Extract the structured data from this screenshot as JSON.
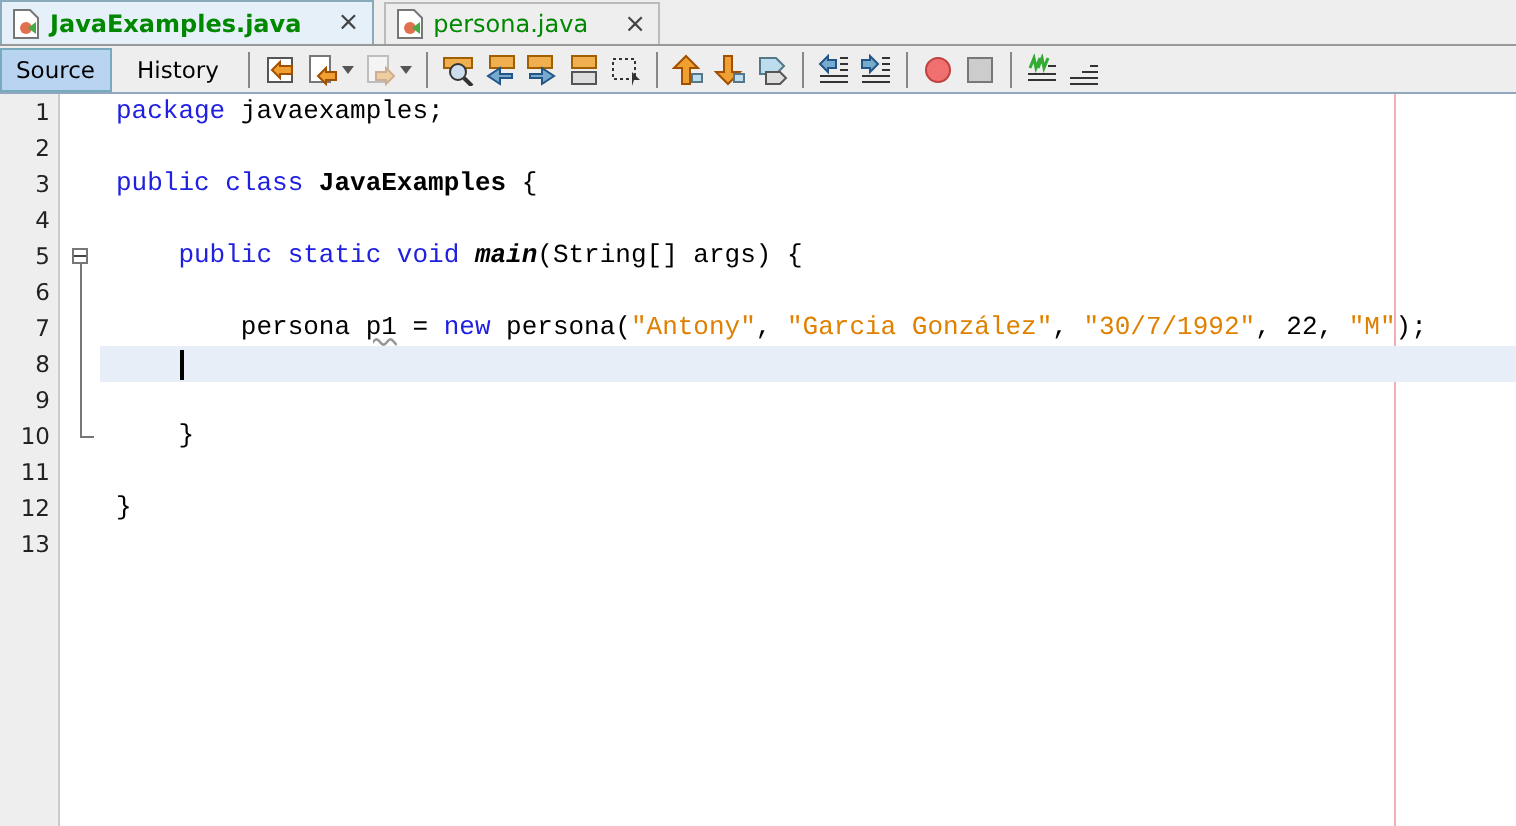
{
  "tabs": [
    {
      "label": "JavaExamples.java",
      "selected": true,
      "close": "×"
    },
    {
      "label": "persona.java",
      "selected": false,
      "close": "×"
    }
  ],
  "view_buttons": [
    {
      "label": "Source",
      "selected": true
    },
    {
      "label": "History",
      "selected": false
    }
  ],
  "toolbar": [
    {
      "kind": "last-edit",
      "disabled": false
    },
    {
      "kind": "back",
      "disabled": false
    },
    {
      "kind": "forward",
      "disabled": true
    },
    {
      "kind": "sep"
    },
    {
      "kind": "find",
      "disabled": false
    },
    {
      "kind": "find-prev",
      "disabled": false
    },
    {
      "kind": "find-next",
      "disabled": false
    },
    {
      "kind": "highlight",
      "disabled": false
    },
    {
      "kind": "rect-select",
      "disabled": false
    },
    {
      "kind": "sep"
    },
    {
      "kind": "up",
      "disabled": false
    },
    {
      "kind": "down",
      "disabled": false
    },
    {
      "kind": "bookmark",
      "disabled": false
    },
    {
      "kind": "sep"
    },
    {
      "kind": "shift-left",
      "disabled": false
    },
    {
      "kind": "shift-right",
      "disabled": false
    },
    {
      "kind": "sep"
    },
    {
      "kind": "record",
      "disabled": false
    },
    {
      "kind": "stop",
      "disabled": false
    },
    {
      "kind": "sep"
    },
    {
      "kind": "comment",
      "disabled": false
    },
    {
      "kind": "uncomment",
      "disabled": false
    }
  ],
  "lines": [
    {
      "number": "1",
      "current": false,
      "tokens": [
        {
          "text": "package",
          "kind": "keyword"
        },
        {
          "text": " javaexamples;",
          "kind": "plain"
        }
      ]
    },
    {
      "number": "2",
      "current": false
    },
    {
      "number": "3",
      "current": false,
      "tokens": [
        {
          "text": "public class",
          "kind": "keyword"
        },
        {
          "text": " JavaExamples",
          "kind": "bold"
        },
        {
          "text": " {",
          "kind": "plain"
        }
      ]
    },
    {
      "number": "4",
      "current": false
    },
    {
      "number": "5",
      "current": false,
      "fold": {
        "expanded": true
      },
      "tokens": [
        {
          "text": "    public static void",
          "kind": "keyword"
        },
        {
          "text": " main",
          "kind": "bolditalic"
        },
        {
          "text": "(String[] args) {",
          "kind": "plain"
        }
      ]
    },
    {
      "number": "6",
      "current": false
    },
    {
      "number": "7",
      "current": false,
      "tokens": [
        {
          "text": "        persona ",
          "kind": "plain"
        },
        {
          "text": "p1",
          "kind": "warning"
        },
        {
          "text": " = ",
          "kind": "plain"
        },
        {
          "text": "new",
          "kind": "keyword"
        },
        {
          "text": " persona(",
          "kind": "plain"
        },
        {
          "text": "\"Antony\"",
          "kind": "string"
        },
        {
          "text": ", ",
          "kind": "plain"
        },
        {
          "text": "\"Garcia González\"",
          "kind": "string"
        },
        {
          "text": ", ",
          "kind": "plain"
        },
        {
          "text": "\"30/7/1992\"",
          "kind": "string"
        },
        {
          "text": ", 22, ",
          "kind": "plain"
        },
        {
          "text": "\"M\"",
          "kind": "string"
        },
        {
          "text": ");",
          "kind": "plain"
        }
      ]
    },
    {
      "number": "8",
      "current": true
    },
    {
      "number": "9",
      "current": false
    },
    {
      "number": "10",
      "current": false,
      "fold_end": true,
      "tokens": [
        {
          "text": "    }",
          "kind": "plain"
        }
      ]
    },
    {
      "number": "11",
      "current": false
    },
    {
      "number": "12",
      "current": false,
      "tokens": [
        {
          "text": "}",
          "kind": "plain"
        }
      ]
    },
    {
      "number": "13",
      "current": false
    }
  ]
}
